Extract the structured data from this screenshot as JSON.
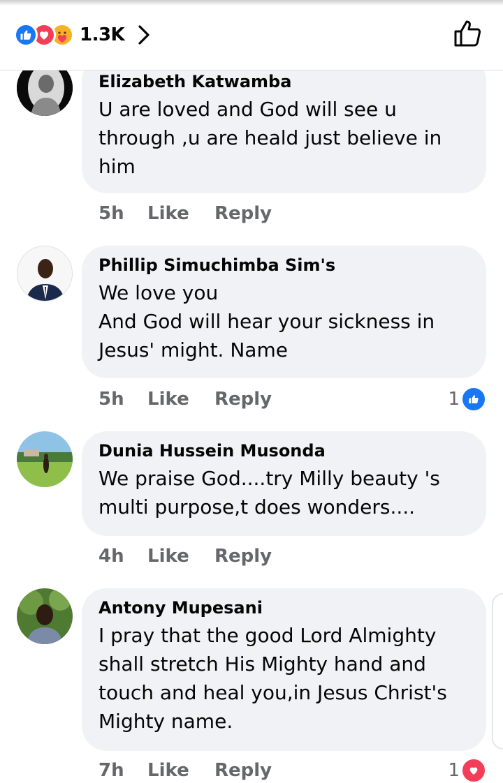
{
  "header": {
    "reaction_icons": [
      "like-icon",
      "love-icon",
      "care-icon"
    ],
    "reaction_count": "1.3K",
    "colors": {
      "like": "#1877f2",
      "love": "#f33e58",
      "care": "#f7b125"
    }
  },
  "comments": [
    {
      "author": "Elizabeth Katwamba",
      "text": "U are loved and God will see u through ,u are heald just believe in him",
      "time": "5h",
      "like_label": "Like",
      "reply_label": "Reply",
      "reaction_count": "",
      "reaction_type": ""
    },
    {
      "author": "Phillip Simuchimba Sim's",
      "text": "We love you\nAnd God will hear your sickness in Jesus' might. Name",
      "time": "5h",
      "like_label": "Like",
      "reply_label": "Reply",
      "reaction_count": "1",
      "reaction_type": "like-icon"
    },
    {
      "author": "Dunia Hussein Musonda",
      "text": "We praise God....try Milly beauty 's multi purpose,t does wonders....",
      "time": "4h",
      "like_label": "Like",
      "reply_label": "Reply",
      "reaction_count": "",
      "reaction_type": ""
    },
    {
      "author": "Antony Mupesani",
      "text": "I pray that the good Lord Almighty shall stretch His Mighty hand and touch and heal you,in Jesus Christ's Mighty name.",
      "time": "7h",
      "like_label": "Like",
      "reply_label": "Reply",
      "reaction_count": "1",
      "reaction_type": "love-icon"
    }
  ]
}
